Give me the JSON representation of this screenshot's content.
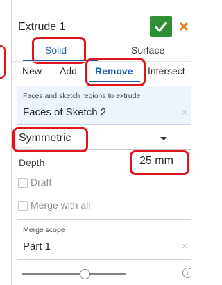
{
  "dialog": {
    "title": "Extrude 1",
    "accept_icon": "checkmark-icon",
    "cancel_icon": "close-icon",
    "colors": {
      "accent": "#1d5fae",
      "accept": "#2f8f36",
      "cancel": "#e07a1f",
      "highlight": "#e0141e"
    }
  },
  "body_type_tabs": [
    "Solid",
    "Surface"
  ],
  "selected_body_type": "Solid",
  "operation_tabs": [
    "New",
    "Add",
    "Remove",
    "Intersect"
  ],
  "selected_operation": "Remove",
  "faces_field": {
    "label": "Faces and sketch regions to extrude",
    "value": "Faces of Sketch 2",
    "clear_symbol": "×"
  },
  "end_type": {
    "value": "Symmetric"
  },
  "depth": {
    "label": "Depth",
    "value": "25 mm"
  },
  "options": {
    "draft": "Draft",
    "merge_with_all": "Merge with all"
  },
  "merge_scope": {
    "label": "Merge scope",
    "value": "Part 1",
    "clear_symbol": "×"
  },
  "help": {
    "symbol": "?"
  }
}
